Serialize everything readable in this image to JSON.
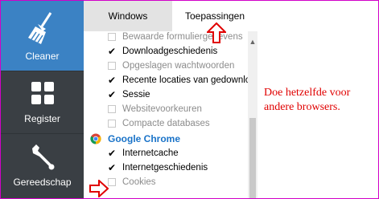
{
  "sidebar": {
    "items": [
      {
        "label": "Cleaner",
        "icon": "broom-icon"
      },
      {
        "label": "Register",
        "icon": "grid-icon"
      },
      {
        "label": "Gereedschap",
        "icon": "wrench-icon"
      }
    ]
  },
  "tabs": [
    {
      "label": "Windows"
    },
    {
      "label": "Toepassingen"
    }
  ],
  "list": {
    "rows": [
      {
        "label": "Bewaarde formuliergegevens",
        "checked": false
      },
      {
        "label": "Downloadgeschiedenis",
        "checked": true
      },
      {
        "label": "Opgeslagen wachtwoorden",
        "checked": false
      },
      {
        "label": "Recente locaties van gedownlo",
        "checked": true
      },
      {
        "label": "Sessie",
        "checked": true
      },
      {
        "label": "Websitevoorkeuren",
        "checked": false
      },
      {
        "label": "Compacte databases",
        "checked": false
      }
    ],
    "section_header": {
      "label": "Google Chrome",
      "icon": "chrome-icon"
    },
    "chrome_rows": [
      {
        "label": "Internetcache",
        "checked": true
      },
      {
        "label": "Internetgeschiedenis",
        "checked": true
      },
      {
        "label": "Cookies",
        "checked": false
      }
    ],
    "check_glyph": "✔"
  },
  "annotation": {
    "text": "Doe hetzelfde voor andere browsers.",
    "color": "#e00000"
  },
  "colors": {
    "sidebar_active": "#3b82c4",
    "sidebar_bg": "#3a3f44",
    "link_blue": "#1a73c8",
    "frame_border": "#d200c8"
  }
}
